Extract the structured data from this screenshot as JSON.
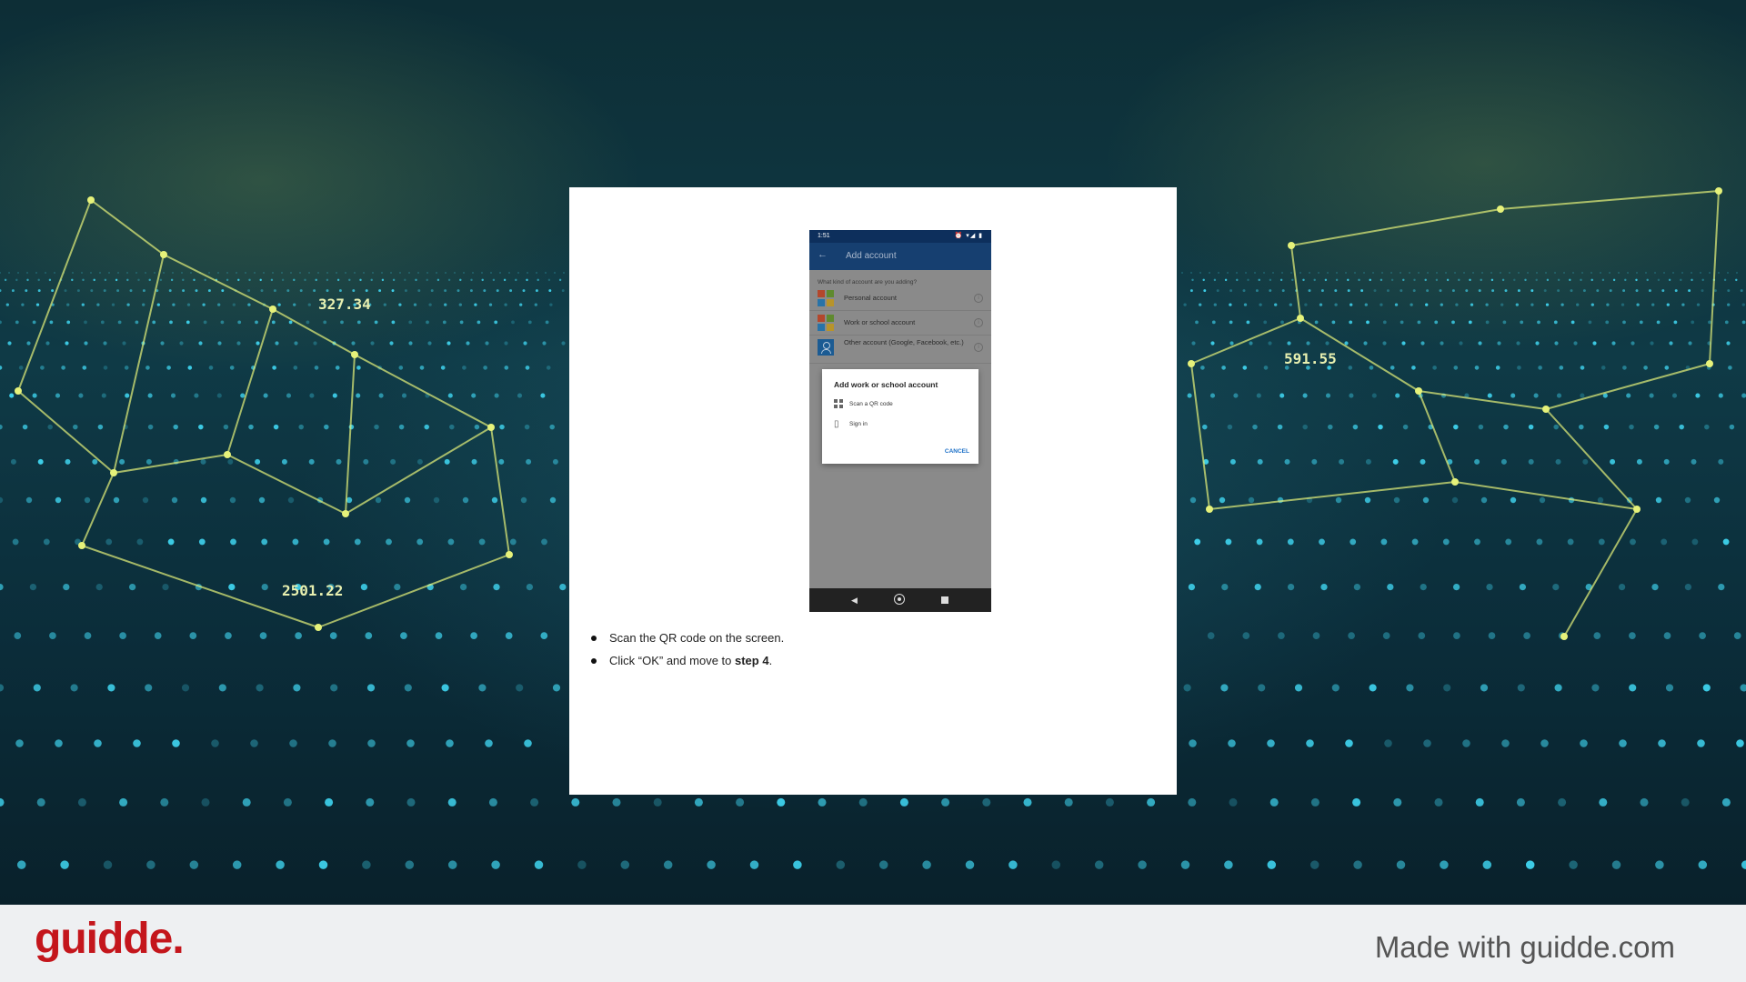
{
  "background": {
    "labels": [
      "591.55",
      "327.34",
      "2501.22"
    ],
    "accent_line": "#e6f27a",
    "accent_dot": "#3fd3ee"
  },
  "phone": {
    "status_time": "1:51",
    "status_icons": "⏰ ▾◢ ▮",
    "app_title": "Add account",
    "question": "What kind of account are you adding?",
    "accounts": [
      {
        "label": "Personal account",
        "icon": "microsoft-logo"
      },
      {
        "label": "Work or school account",
        "icon": "microsoft-logo"
      },
      {
        "label": "Other account (Google, Facebook, etc.)",
        "icon": "person-icon"
      }
    ],
    "dialog": {
      "title": "Add work or school account",
      "options": [
        {
          "label": "Scan a QR code",
          "icon": "qr-code-icon"
        },
        {
          "label": "Sign in",
          "icon": "sign-in-icon"
        }
      ],
      "cancel_label": "CANCEL"
    }
  },
  "steps": {
    "step1": "Scan the QR code on the screen.",
    "step2_prefix": "Click “OK” and move to ",
    "step2_bold": "step 4",
    "step2_suffix": "."
  },
  "footer": {
    "logo_text": "guidde.",
    "made_with": "Made with guidde.com",
    "brand_color": "#c4161c"
  }
}
